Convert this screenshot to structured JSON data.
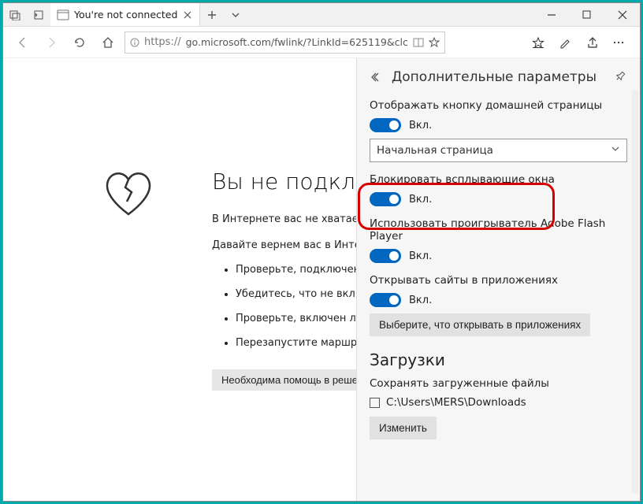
{
  "tab": {
    "title": "You're not connected"
  },
  "url": {
    "scheme": "https://",
    "rest": "go.microsoft.com/fwlink/?LinkId=625119&clc"
  },
  "page": {
    "heading": "Вы не подключены",
    "sub1": "В Интернете вас не хватает.",
    "sub2": "Давайте вернем вас в Интернет",
    "bullets": [
      "Проверьте, подключены ли",
      "Убедитесь, что не включен реж",
      "Проверьте, включен ли беспр",
      "Перезапустите маршрутизат"
    ],
    "help_button": "Необходима помощь в решен"
  },
  "settings": {
    "title": "Дополнительные параметры",
    "home_button": {
      "label": "Отображать кнопку домашней страницы",
      "state": "Вкл."
    },
    "start_page_select": "Начальная страница",
    "popups": {
      "label": "Блокировать всплывающие окна",
      "state": "Вкл."
    },
    "flash": {
      "label": "Использовать проигрыватель Adobe Flash Player",
      "state": "Вкл."
    },
    "open_apps": {
      "label": "Открывать сайты в приложениях",
      "state": "Вкл."
    },
    "open_apps_button": "Выберите, что открывать в приложениях",
    "downloads": {
      "heading": "Загрузки",
      "desc": "Сохранять загруженные файлы",
      "path": "C:\\Users\\MERS\\Downloads",
      "change_button": "Изменить"
    }
  }
}
